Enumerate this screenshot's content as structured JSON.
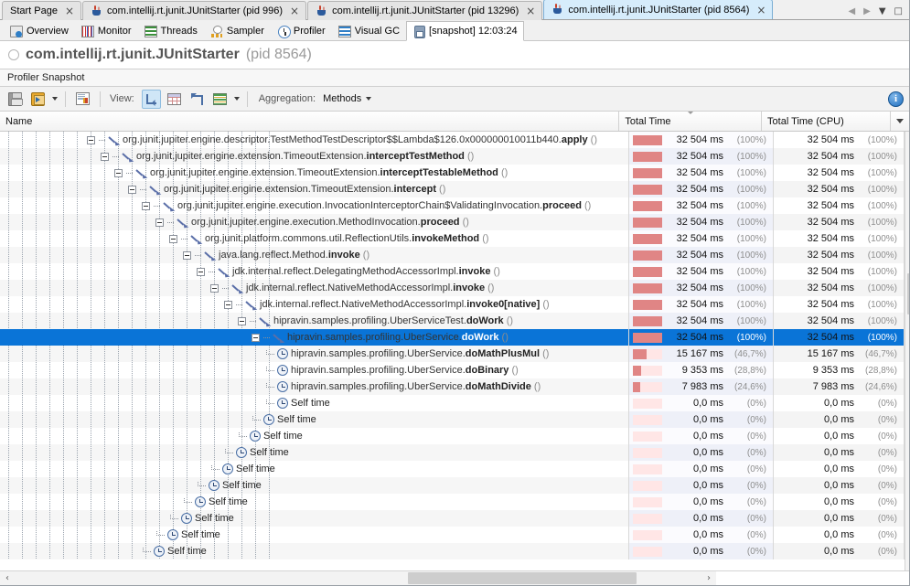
{
  "window": {
    "tabs": [
      {
        "label": "Start Page",
        "icon": null,
        "active": false,
        "closable": true
      },
      {
        "label": "com.intellij.rt.junit.JUnitStarter (pid 996)",
        "icon": "java-icon",
        "active": false,
        "closable": true
      },
      {
        "label": "com.intellij.rt.junit.JUnitStarter (pid 13296)",
        "icon": "java-icon",
        "active": false,
        "closable": true
      },
      {
        "label": "com.intellij.rt.junit.JUnitStarter (pid 8564)",
        "icon": "java-icon",
        "active": true,
        "closable": true
      }
    ],
    "close_glyph": "×",
    "controls": [
      {
        "name": "nav-back-icon",
        "glyph": "◀"
      },
      {
        "name": "nav-forward-icon",
        "glyph": "▶"
      },
      {
        "name": "tab-list-icon",
        "glyph": "▼"
      },
      {
        "name": "maximize-icon",
        "glyph": "□"
      }
    ]
  },
  "view_tabs": [
    {
      "label": "Overview",
      "icon": "overview-icon",
      "active": false
    },
    {
      "label": "Monitor",
      "icon": "monitor-icon",
      "active": false
    },
    {
      "label": "Threads",
      "icon": "threads-icon",
      "active": false
    },
    {
      "label": "Sampler",
      "icon": "sampler-icon",
      "active": false
    },
    {
      "label": "Profiler",
      "icon": "profiler-icon",
      "active": false
    },
    {
      "label": "Visual GC",
      "icon": "visualgc-icon",
      "active": false
    },
    {
      "label": "[snapshot] 12:03:24",
      "icon": "snapshot-icon",
      "active": true
    }
  ],
  "header": {
    "app_name": "com.intellij.rt.junit.JUnitStarter",
    "pid": "(pid 8564)",
    "section_label": "Profiler Snapshot"
  },
  "toolbar": {
    "save_icon": "save-icon",
    "export_icon": "export-icon",
    "export_caret": "caret-down-icon",
    "report_icon": "report-icon",
    "view_label": "View:",
    "view_tree_icon": "call-tree-icon",
    "view_grid_icon": "hot-spots-icon",
    "view_back_icon": "back-traces-icon",
    "columns_icon": "columns-icon",
    "columns_caret": "caret-down-icon",
    "aggregation_label": "Aggregation:",
    "aggregation_value": "Methods",
    "aggregation_caret": "caret-down-icon",
    "info_icon": "info-icon",
    "info_glyph": "i"
  },
  "table": {
    "columns": [
      {
        "key": "name",
        "label": "Name",
        "sorted": false
      },
      {
        "key": "total_time",
        "label": "Total Time",
        "sorted": true
      },
      {
        "key": "total_time_cpu",
        "label": "Total Time (CPU)",
        "sorted": false
      }
    ],
    "header_menu_icon": "column-chooser-icon",
    "rows": [
      {
        "depth": 6,
        "node": "call",
        "expander": "minus",
        "pkg": "org.junit.jupiter.engine.descriptor.TestMethodTestDescriptor$$Lambda$126.0x000000010011b440.",
        "method": "apply",
        "parens": "()",
        "total_time": "32 504 ms",
        "total_pct": "(100%)",
        "cpu_time": "32 504 ms",
        "cpu_pct": "(100%)",
        "bar_fill": 100,
        "selected": false
      },
      {
        "depth": 7,
        "node": "call",
        "expander": "minus",
        "pkg": "org.junit.jupiter.engine.extension.TimeoutExtension.",
        "method": "interceptTestMethod",
        "parens": "()",
        "total_time": "32 504 ms",
        "total_pct": "(100%)",
        "cpu_time": "32 504 ms",
        "cpu_pct": "(100%)",
        "bar_fill": 100,
        "selected": false
      },
      {
        "depth": 8,
        "node": "call",
        "expander": "minus",
        "pkg": "org.junit.jupiter.engine.extension.TimeoutExtension.",
        "method": "interceptTestableMethod",
        "parens": "()",
        "total_time": "32 504 ms",
        "total_pct": "(100%)",
        "cpu_time": "32 504 ms",
        "cpu_pct": "(100%)",
        "bar_fill": 100,
        "selected": false
      },
      {
        "depth": 9,
        "node": "call",
        "expander": "minus",
        "pkg": "org.junit.jupiter.engine.extension.TimeoutExtension.",
        "method": "intercept",
        "parens": "()",
        "total_time": "32 504 ms",
        "total_pct": "(100%)",
        "cpu_time": "32 504 ms",
        "cpu_pct": "(100%)",
        "bar_fill": 100,
        "selected": false
      },
      {
        "depth": 10,
        "node": "call",
        "expander": "minus",
        "pkg": "org.junit.jupiter.engine.execution.InvocationInterceptorChain$ValidatingInvocation.",
        "method": "proceed",
        "parens": "()",
        "total_time": "32 504 ms",
        "total_pct": "(100%)",
        "cpu_time": "32 504 ms",
        "cpu_pct": "(100%)",
        "bar_fill": 100,
        "selected": false
      },
      {
        "depth": 11,
        "node": "call",
        "expander": "minus",
        "pkg": "org.junit.jupiter.engine.execution.MethodInvocation.",
        "method": "proceed",
        "parens": "()",
        "total_time": "32 504 ms",
        "total_pct": "(100%)",
        "cpu_time": "32 504 ms",
        "cpu_pct": "(100%)",
        "bar_fill": 100,
        "selected": false
      },
      {
        "depth": 12,
        "node": "call",
        "expander": "minus",
        "pkg": "org.junit.platform.commons.util.ReflectionUtils.",
        "method": "invokeMethod",
        "parens": "()",
        "total_time": "32 504 ms",
        "total_pct": "(100%)",
        "cpu_time": "32 504 ms",
        "cpu_pct": "(100%)",
        "bar_fill": 100,
        "selected": false
      },
      {
        "depth": 13,
        "node": "call",
        "expander": "minus",
        "pkg": "java.lang.reflect.Method.",
        "method": "invoke",
        "parens": "()",
        "total_time": "32 504 ms",
        "total_pct": "(100%)",
        "cpu_time": "32 504 ms",
        "cpu_pct": "(100%)",
        "bar_fill": 100,
        "selected": false
      },
      {
        "depth": 14,
        "node": "call",
        "expander": "minus",
        "pkg": "jdk.internal.reflect.DelegatingMethodAccessorImpl.",
        "method": "invoke",
        "parens": "()",
        "total_time": "32 504 ms",
        "total_pct": "(100%)",
        "cpu_time": "32 504 ms",
        "cpu_pct": "(100%)",
        "bar_fill": 100,
        "selected": false
      },
      {
        "depth": 15,
        "node": "call",
        "expander": "minus",
        "pkg": "jdk.internal.reflect.NativeMethodAccessorImpl.",
        "method": "invoke",
        "parens": "()",
        "total_time": "32 504 ms",
        "total_pct": "(100%)",
        "cpu_time": "32 504 ms",
        "cpu_pct": "(100%)",
        "bar_fill": 100,
        "selected": false
      },
      {
        "depth": 16,
        "node": "call",
        "expander": "minus",
        "pkg": "jdk.internal.reflect.NativeMethodAccessorImpl.",
        "method": "invoke0[native]",
        "parens": "()",
        "total_time": "32 504 ms",
        "total_pct": "(100%)",
        "cpu_time": "32 504 ms",
        "cpu_pct": "(100%)",
        "bar_fill": 100,
        "selected": false
      },
      {
        "depth": 17,
        "node": "call",
        "expander": "minus",
        "pkg": "hipravin.samples.profiling.UberServiceTest.",
        "method": "doWork",
        "parens": "()",
        "total_time": "32 504 ms",
        "total_pct": "(100%)",
        "cpu_time": "32 504 ms",
        "cpu_pct": "(100%)",
        "bar_fill": 100,
        "selected": false
      },
      {
        "depth": 18,
        "node": "call",
        "expander": "minus",
        "pkg": "hipravin.samples.profiling.UberService.",
        "method": "doWork",
        "parens": "()",
        "total_time": "32 504 ms",
        "total_pct": "(100%)",
        "cpu_time": "32 504 ms",
        "cpu_pct": "(100%)",
        "bar_fill": 100,
        "selected": true
      },
      {
        "depth": 19,
        "node": "clock",
        "expander": "none",
        "pkg": "hipravin.samples.profiling.UberService.",
        "method": "doMathPlusMul",
        "parens": "()",
        "total_time": "15 167 ms",
        "total_pct": "(46,7%)",
        "cpu_time": "15 167 ms",
        "cpu_pct": "(46,7%)",
        "bar_fill": 47,
        "selected": false
      },
      {
        "depth": 19,
        "node": "clock",
        "expander": "none",
        "pkg": "hipravin.samples.profiling.UberService.",
        "method": "doBinary",
        "parens": "()",
        "total_time": "9 353 ms",
        "total_pct": "(28,8%)",
        "cpu_time": "9 353 ms",
        "cpu_pct": "(28,8%)",
        "bar_fill": 29,
        "selected": false
      },
      {
        "depth": 19,
        "node": "clock",
        "expander": "none",
        "pkg": "hipravin.samples.profiling.UberService.",
        "method": "doMathDivide",
        "parens": "()",
        "total_time": "7 983 ms",
        "total_pct": "(24,6%)",
        "cpu_time": "7 983 ms",
        "cpu_pct": "(24,6%)",
        "bar_fill": 25,
        "selected": false
      },
      {
        "depth": 19,
        "node": "clock",
        "expander": "none",
        "pkg": "",
        "method": "",
        "label": "Self time",
        "parens": "",
        "total_time": "0,0 ms",
        "total_pct": "(0%)",
        "cpu_time": "0,0 ms",
        "cpu_pct": "(0%)",
        "bar_fill": 0,
        "selected": false
      },
      {
        "depth": 18,
        "node": "clock",
        "expander": "none",
        "pkg": "",
        "method": "",
        "label": "Self time",
        "parens": "",
        "total_time": "0,0 ms",
        "total_pct": "(0%)",
        "cpu_time": "0,0 ms",
        "cpu_pct": "(0%)",
        "bar_fill": 0,
        "selected": false
      },
      {
        "depth": 17,
        "node": "clock",
        "expander": "none",
        "pkg": "",
        "method": "",
        "label": "Self time",
        "parens": "",
        "total_time": "0,0 ms",
        "total_pct": "(0%)",
        "cpu_time": "0,0 ms",
        "cpu_pct": "(0%)",
        "bar_fill": 0,
        "selected": false
      },
      {
        "depth": 16,
        "node": "clock",
        "expander": "none",
        "pkg": "",
        "method": "",
        "label": "Self time",
        "parens": "",
        "total_time": "0,0 ms",
        "total_pct": "(0%)",
        "cpu_time": "0,0 ms",
        "cpu_pct": "(0%)",
        "bar_fill": 0,
        "selected": false
      },
      {
        "depth": 15,
        "node": "clock",
        "expander": "none",
        "pkg": "",
        "method": "",
        "label": "Self time",
        "parens": "",
        "total_time": "0,0 ms",
        "total_pct": "(0%)",
        "cpu_time": "0,0 ms",
        "cpu_pct": "(0%)",
        "bar_fill": 0,
        "selected": false
      },
      {
        "depth": 14,
        "node": "clock",
        "expander": "none",
        "pkg": "",
        "method": "",
        "label": "Self time",
        "parens": "",
        "total_time": "0,0 ms",
        "total_pct": "(0%)",
        "cpu_time": "0,0 ms",
        "cpu_pct": "(0%)",
        "bar_fill": 0,
        "selected": false
      },
      {
        "depth": 13,
        "node": "clock",
        "expander": "none",
        "pkg": "",
        "method": "",
        "label": "Self time",
        "parens": "",
        "total_time": "0,0 ms",
        "total_pct": "(0%)",
        "cpu_time": "0,0 ms",
        "cpu_pct": "(0%)",
        "bar_fill": 0,
        "selected": false
      },
      {
        "depth": 12,
        "node": "clock",
        "expander": "none",
        "pkg": "",
        "method": "",
        "label": "Self time",
        "parens": "",
        "total_time": "0,0 ms",
        "total_pct": "(0%)",
        "cpu_time": "0,0 ms",
        "cpu_pct": "(0%)",
        "bar_fill": 0,
        "selected": false
      },
      {
        "depth": 11,
        "node": "clock",
        "expander": "none",
        "pkg": "",
        "method": "",
        "label": "Self time",
        "parens": "",
        "total_time": "0,0 ms",
        "total_pct": "(0%)",
        "cpu_time": "0,0 ms",
        "cpu_pct": "(0%)",
        "bar_fill": 0,
        "selected": false
      },
      {
        "depth": 10,
        "node": "clock",
        "expander": "none",
        "pkg": "",
        "method": "",
        "label": "Self time",
        "parens": "",
        "total_time": "0,0 ms",
        "total_pct": "(0%)",
        "cpu_time": "0,0 ms",
        "cpu_pct": "(0%)",
        "bar_fill": 0,
        "selected": false
      }
    ]
  },
  "scrollbars": {
    "vertical_up_glyph": "∧",
    "vertical_down_glyph": "∨",
    "horizontal_left_glyph": "‹",
    "horizontal_right_glyph": "›"
  }
}
